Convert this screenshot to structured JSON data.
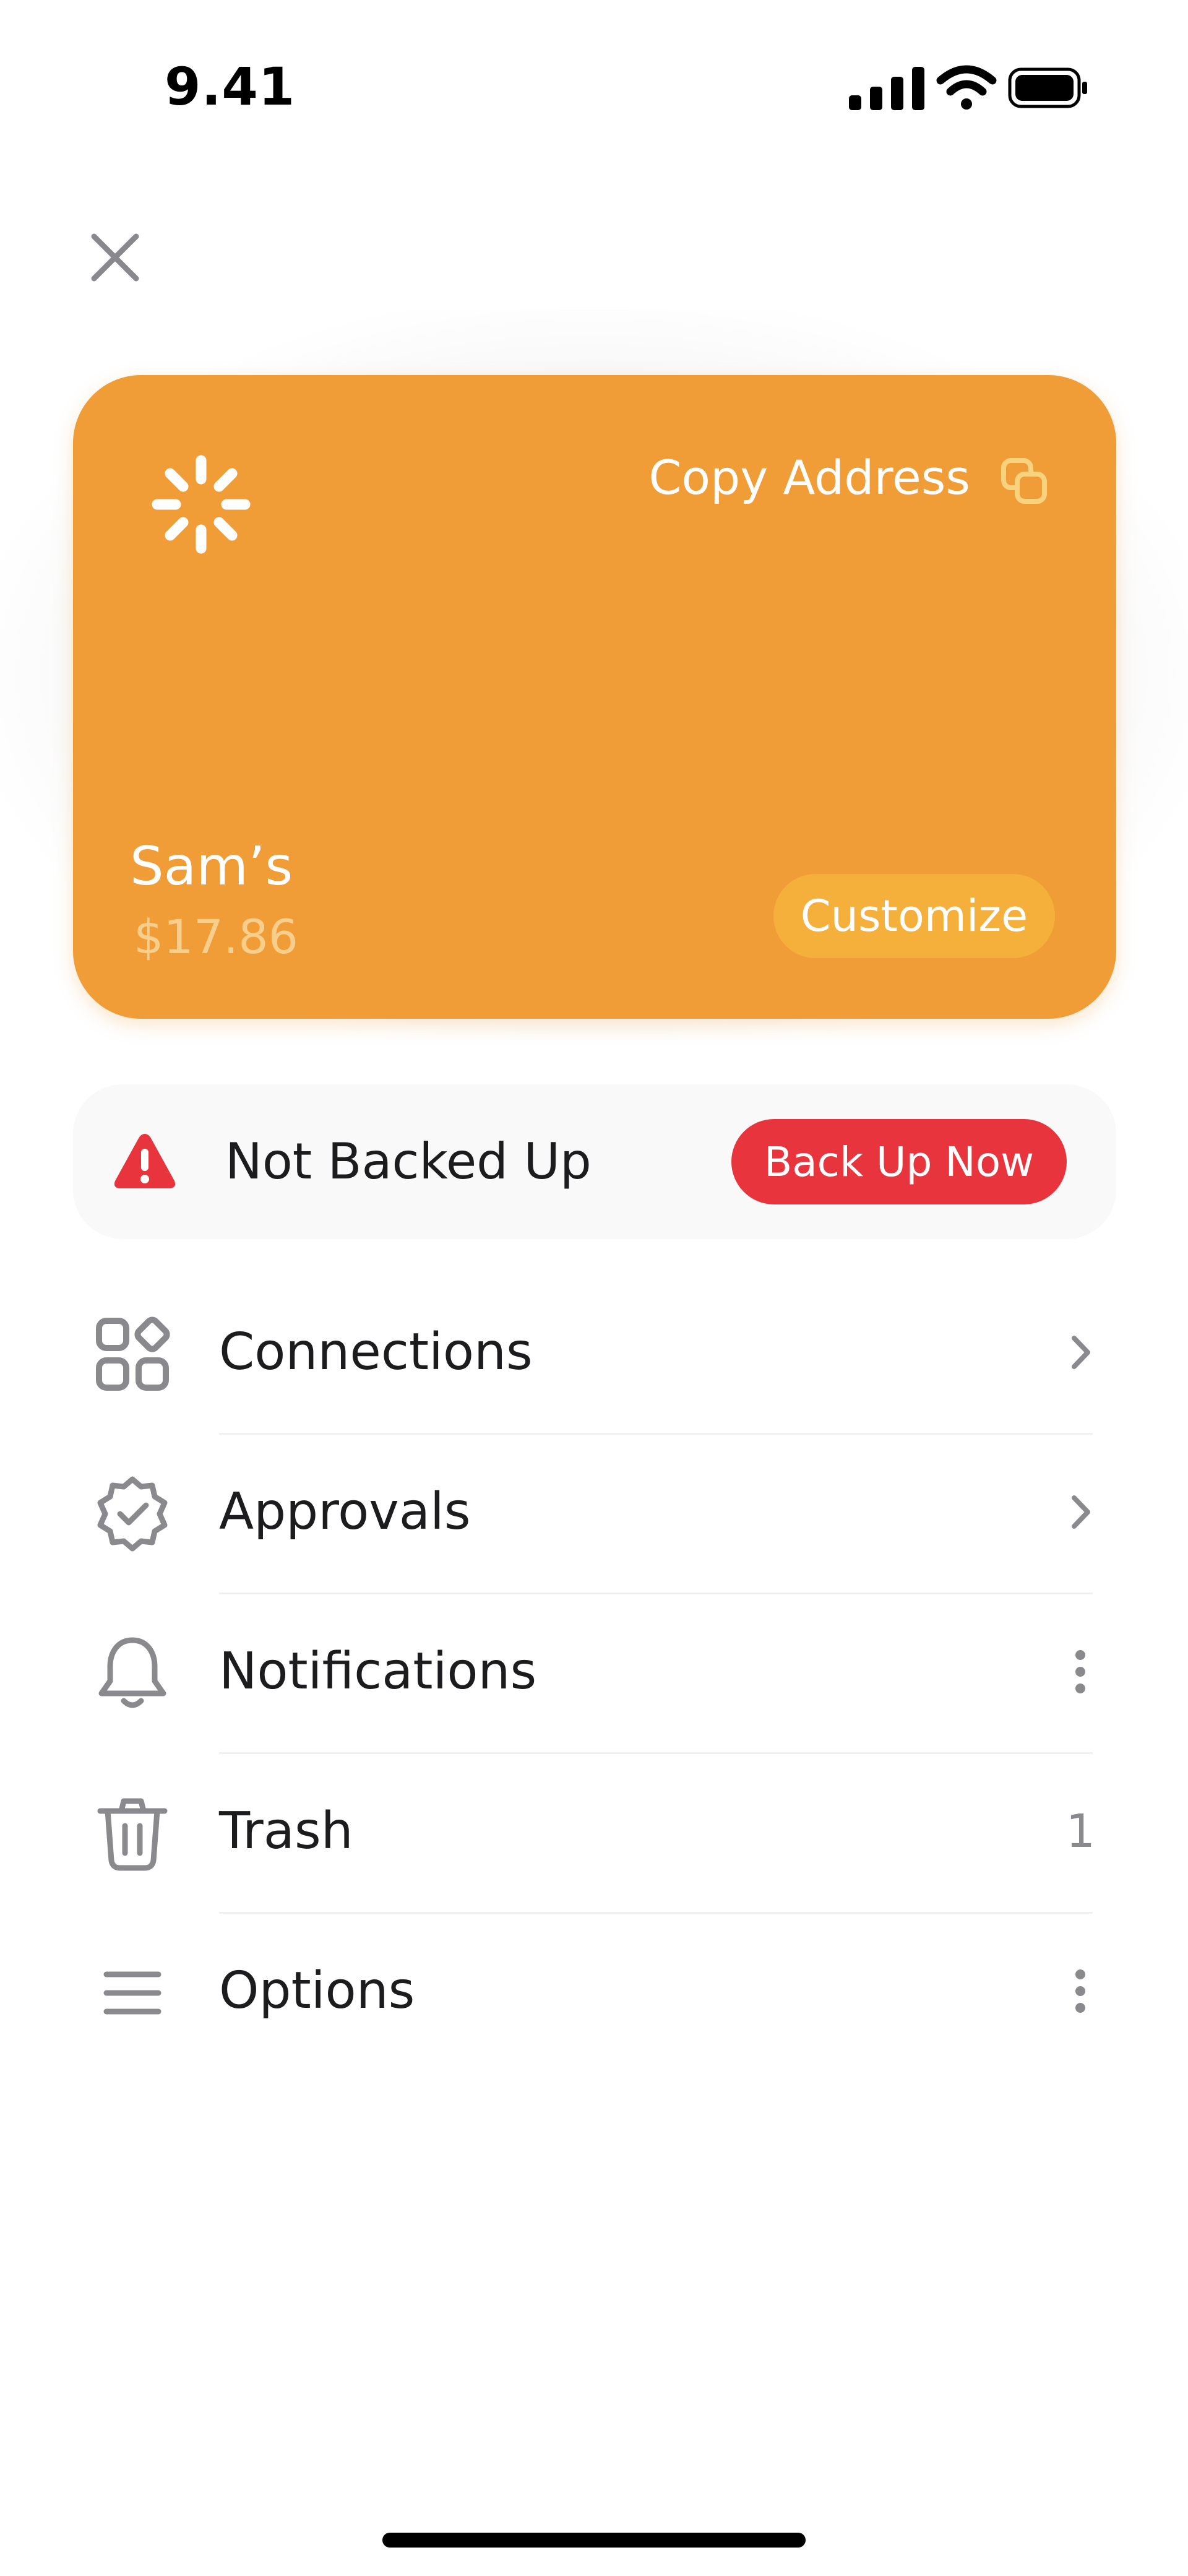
{
  "status_bar": {
    "time": "9.41",
    "icons": [
      "cellular-signal-icon",
      "wifi-icon",
      "battery-icon"
    ]
  },
  "header": {
    "close_icon": "close-icon"
  },
  "wallet_card": {
    "name": "Sam’s",
    "balance": "$17.86",
    "copy_address_label": "Copy Address",
    "customize_label": "Customize",
    "card_color": "#f09d38",
    "customize_button_color": "#f4b03a",
    "balance_color": "#f8ce8c"
  },
  "backup_banner": {
    "label": "Not Backed Up",
    "button_label": "Back Up Now",
    "alert_color": "#e8353d"
  },
  "menu": {
    "items": [
      {
        "label": "Connections",
        "icon": "connections-icon",
        "trailing": "chevron-right-icon"
      },
      {
        "label": "Approvals",
        "icon": "approval-badge-icon",
        "trailing": "chevron-right-icon"
      },
      {
        "label": "Notifications",
        "icon": "bell-icon",
        "trailing": "more-vertical-icon"
      },
      {
        "label": "Trash",
        "icon": "trash-icon",
        "trailing_text": "1"
      },
      {
        "label": "Options",
        "icon": "menu-lines-icon",
        "trailing": "more-vertical-icon"
      }
    ]
  }
}
